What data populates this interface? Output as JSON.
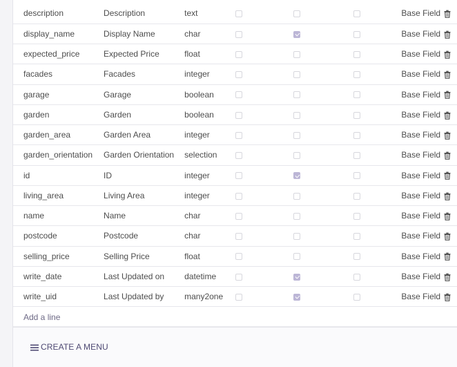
{
  "fields": [
    {
      "name": "description",
      "label": "Description",
      "type": "text",
      "c1": false,
      "c2": false,
      "c3": false,
      "source": "Base Field"
    },
    {
      "name": "display_name",
      "label": "Display Name",
      "type": "char",
      "c1": false,
      "c2": true,
      "c3": false,
      "source": "Base Field"
    },
    {
      "name": "expected_price",
      "label": "Expected Price",
      "type": "float",
      "c1": false,
      "c2": false,
      "c3": false,
      "source": "Base Field"
    },
    {
      "name": "facades",
      "label": "Facades",
      "type": "integer",
      "c1": false,
      "c2": false,
      "c3": false,
      "source": "Base Field"
    },
    {
      "name": "garage",
      "label": "Garage",
      "type": "boolean",
      "c1": false,
      "c2": false,
      "c3": false,
      "source": "Base Field"
    },
    {
      "name": "garden",
      "label": "Garden",
      "type": "boolean",
      "c1": false,
      "c2": false,
      "c3": false,
      "source": "Base Field"
    },
    {
      "name": "garden_area",
      "label": "Garden Area",
      "type": "integer",
      "c1": false,
      "c2": false,
      "c3": false,
      "source": "Base Field"
    },
    {
      "name": "garden_orientation",
      "label": "Garden Orientation",
      "type": "selection",
      "c1": false,
      "c2": false,
      "c3": false,
      "source": "Base Field"
    },
    {
      "name": "id",
      "label": "ID",
      "type": "integer",
      "c1": false,
      "c2": true,
      "c3": false,
      "source": "Base Field"
    },
    {
      "name": "living_area",
      "label": "Living Area",
      "type": "integer",
      "c1": false,
      "c2": false,
      "c3": false,
      "source": "Base Field"
    },
    {
      "name": "name",
      "label": "Name",
      "type": "char",
      "c1": false,
      "c2": false,
      "c3": false,
      "source": "Base Field"
    },
    {
      "name": "postcode",
      "label": "Postcode",
      "type": "char",
      "c1": false,
      "c2": false,
      "c3": false,
      "source": "Base Field"
    },
    {
      "name": "selling_price",
      "label": "Selling Price",
      "type": "float",
      "c1": false,
      "c2": false,
      "c3": false,
      "source": "Base Field"
    },
    {
      "name": "write_date",
      "label": "Last Updated on",
      "type": "datetime",
      "c1": false,
      "c2": true,
      "c3": false,
      "source": "Base Field"
    },
    {
      "name": "write_uid",
      "label": "Last Updated by",
      "type": "many2one",
      "c1": false,
      "c2": true,
      "c3": false,
      "source": "Base Field"
    }
  ],
  "add_line_label": "Add a line",
  "create_menu_label": "CREATE A MENU",
  "icons": {
    "delete": "trash-icon",
    "menu": "hamburger-menu-icon"
  },
  "colors": {
    "checked": "#bcb6d6",
    "link": "#4d4872"
  }
}
